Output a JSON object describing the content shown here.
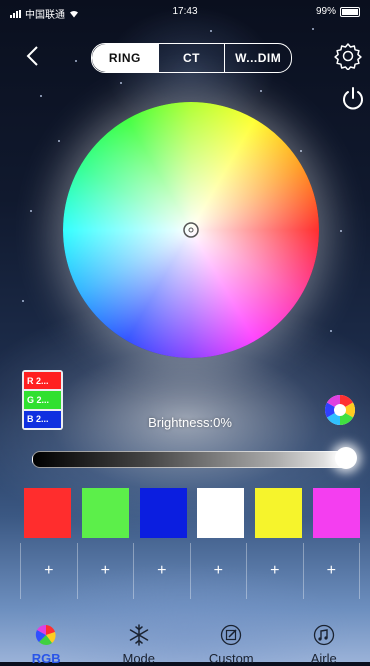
{
  "status_bar": {
    "carrier": "中国联通",
    "time": "17:43",
    "battery": "99%"
  },
  "tabs": [
    {
      "label": "RING",
      "active": true
    },
    {
      "label": "CT",
      "active": false
    },
    {
      "label": "W...DIM",
      "active": false
    }
  ],
  "rgb_readout": {
    "r": "R 2...",
    "g": "G 2...",
    "b": "B 2..."
  },
  "brightness": {
    "label": "Brightness:0%",
    "value_percent": 0
  },
  "swatches": [
    {
      "color": "#ff2d2d"
    },
    {
      "color": "#5cef4a"
    },
    {
      "color": "#0b1ee0"
    },
    {
      "color": "#ffffff"
    },
    {
      "color": "#f6f42c"
    },
    {
      "color": "#f43ef0"
    }
  ],
  "slots": [
    "+",
    "+",
    "+",
    "+",
    "+",
    "+"
  ],
  "nav": [
    {
      "label": "RGB",
      "icon": "rgb-color-icon",
      "active": true
    },
    {
      "label": "Mode",
      "icon": "snowflake-icon",
      "active": false
    },
    {
      "label": "Custom",
      "icon": "edit-icon",
      "active": false
    },
    {
      "label": "Airle",
      "icon": "music-icon",
      "active": false
    }
  ],
  "colors": {
    "accent": "#2a55e8"
  }
}
